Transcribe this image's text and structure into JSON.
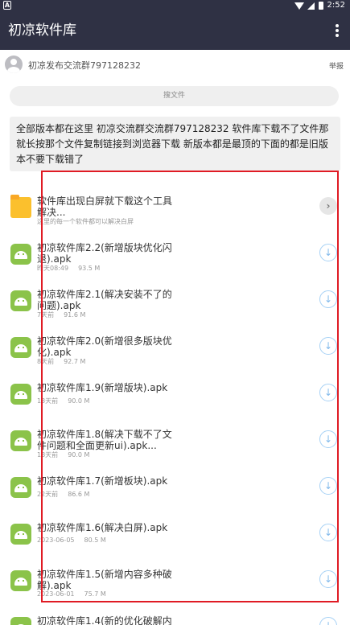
{
  "status_bar": {
    "carrier_icon": "A",
    "time": "2:52",
    "icons": [
      "wifi-icon",
      "signal-icon",
      "battery-icon"
    ]
  },
  "app_bar": {
    "title": "初凉软件库",
    "menu_icon": "more-vert-icon"
  },
  "uploader": {
    "name": "初凉发布交流群797128232",
    "report_label": "举报"
  },
  "search": {
    "placeholder": "搜文件"
  },
  "notice": {
    "text": "全部版本都在这里 初凉交流群交流群797128232 软件库下载不了文件那就长按那个文件复制链接到浏览器下载 新版本都是最顶的下面的都是旧版本不要下载错了"
  },
  "files": [
    {
      "type": "folder",
      "title": "软件库出现白屏就下载这个工具解决...",
      "meta_left": "这里的每一个软件都可以解决白屏",
      "meta_right": "",
      "action": "chevron-right-icon"
    },
    {
      "type": "apk",
      "title": "初凉软件库2.2(新增版块优化闪退).apk",
      "meta_left": "昨天08:49",
      "meta_right": "93.5 M",
      "action": "download-icon"
    },
    {
      "type": "apk",
      "title": "初凉软件库2.1(解决安装不了的问题).apk",
      "meta_left": "7天前",
      "meta_right": "91.6 M",
      "action": "download-icon"
    },
    {
      "type": "apk",
      "title": "初凉软件库2.0(新增很多版块优化).apk",
      "meta_left": "8天前",
      "meta_right": "92.7 M",
      "action": "download-icon"
    },
    {
      "type": "apk",
      "title": "初凉软件库1.9(新增版块).apk",
      "meta_left": "13天前",
      "meta_right": "90.0 M",
      "action": "download-icon"
    },
    {
      "type": "apk",
      "title": "初凉软件库1.8(解决下载不了文件问题和全面更新ui).apk...",
      "meta_left": "18天前",
      "meta_right": "90.0 M",
      "action": "download-icon"
    },
    {
      "type": "apk",
      "title": "初凉软件库1.7(新增板块).apk",
      "meta_left": "22天前",
      "meta_right": "86.6 M",
      "action": "download-icon"
    },
    {
      "type": "apk",
      "title": "初凉软件库1.6(解决白屏).apk",
      "meta_left": "2023-06-05",
      "meta_right": "80.5 M",
      "action": "download-icon"
    },
    {
      "type": "apk",
      "title": "初凉软件库1.5(新增内容多种破解).apk",
      "meta_left": "2023-06-01",
      "meta_right": "75.7 M",
      "action": "download-icon"
    },
    {
      "type": "apk",
      "title": "初凉软件库1.4(新的优化破解内",
      "meta_left": "",
      "meta_right": "",
      "action": "download-icon"
    }
  ],
  "colors": {
    "header_bg": "#2f3144",
    "highlight_border": "#e01b24",
    "apk_icon": "#8bc34a",
    "folder_icon": "#fbc02d",
    "download_ring": "#a6d1f5"
  }
}
